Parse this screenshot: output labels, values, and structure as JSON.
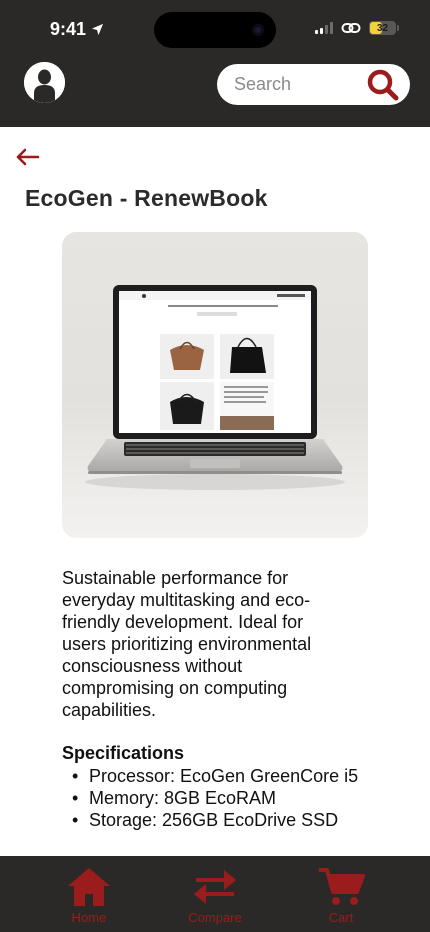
{
  "status_bar": {
    "time": "9:41",
    "battery": "32"
  },
  "header": {
    "search_placeholder": "Search"
  },
  "product": {
    "title": "EcoGen - RenewBook",
    "description": "Sustainable performance for everyday multitasking and eco-friendly development. Ideal for users prioritizing environmental consciousness without compromising on computing capabilities.",
    "specs_heading": "Specifications",
    "specs": [
      "Processor: EcoGen GreenCore i5",
      "Memory: 8GB EcoRAM",
      "Storage: 256GB EcoDrive SSD"
    ]
  },
  "nav": {
    "items": [
      {
        "label": "Home",
        "icon": "home-icon"
      },
      {
        "label": "Compare",
        "icon": "compare-icon"
      },
      {
        "label": "Cart",
        "icon": "cart-icon"
      }
    ]
  },
  "colors": {
    "header_bg": "#2b2927",
    "accent": "#9b1c1c",
    "text": "#111111"
  }
}
